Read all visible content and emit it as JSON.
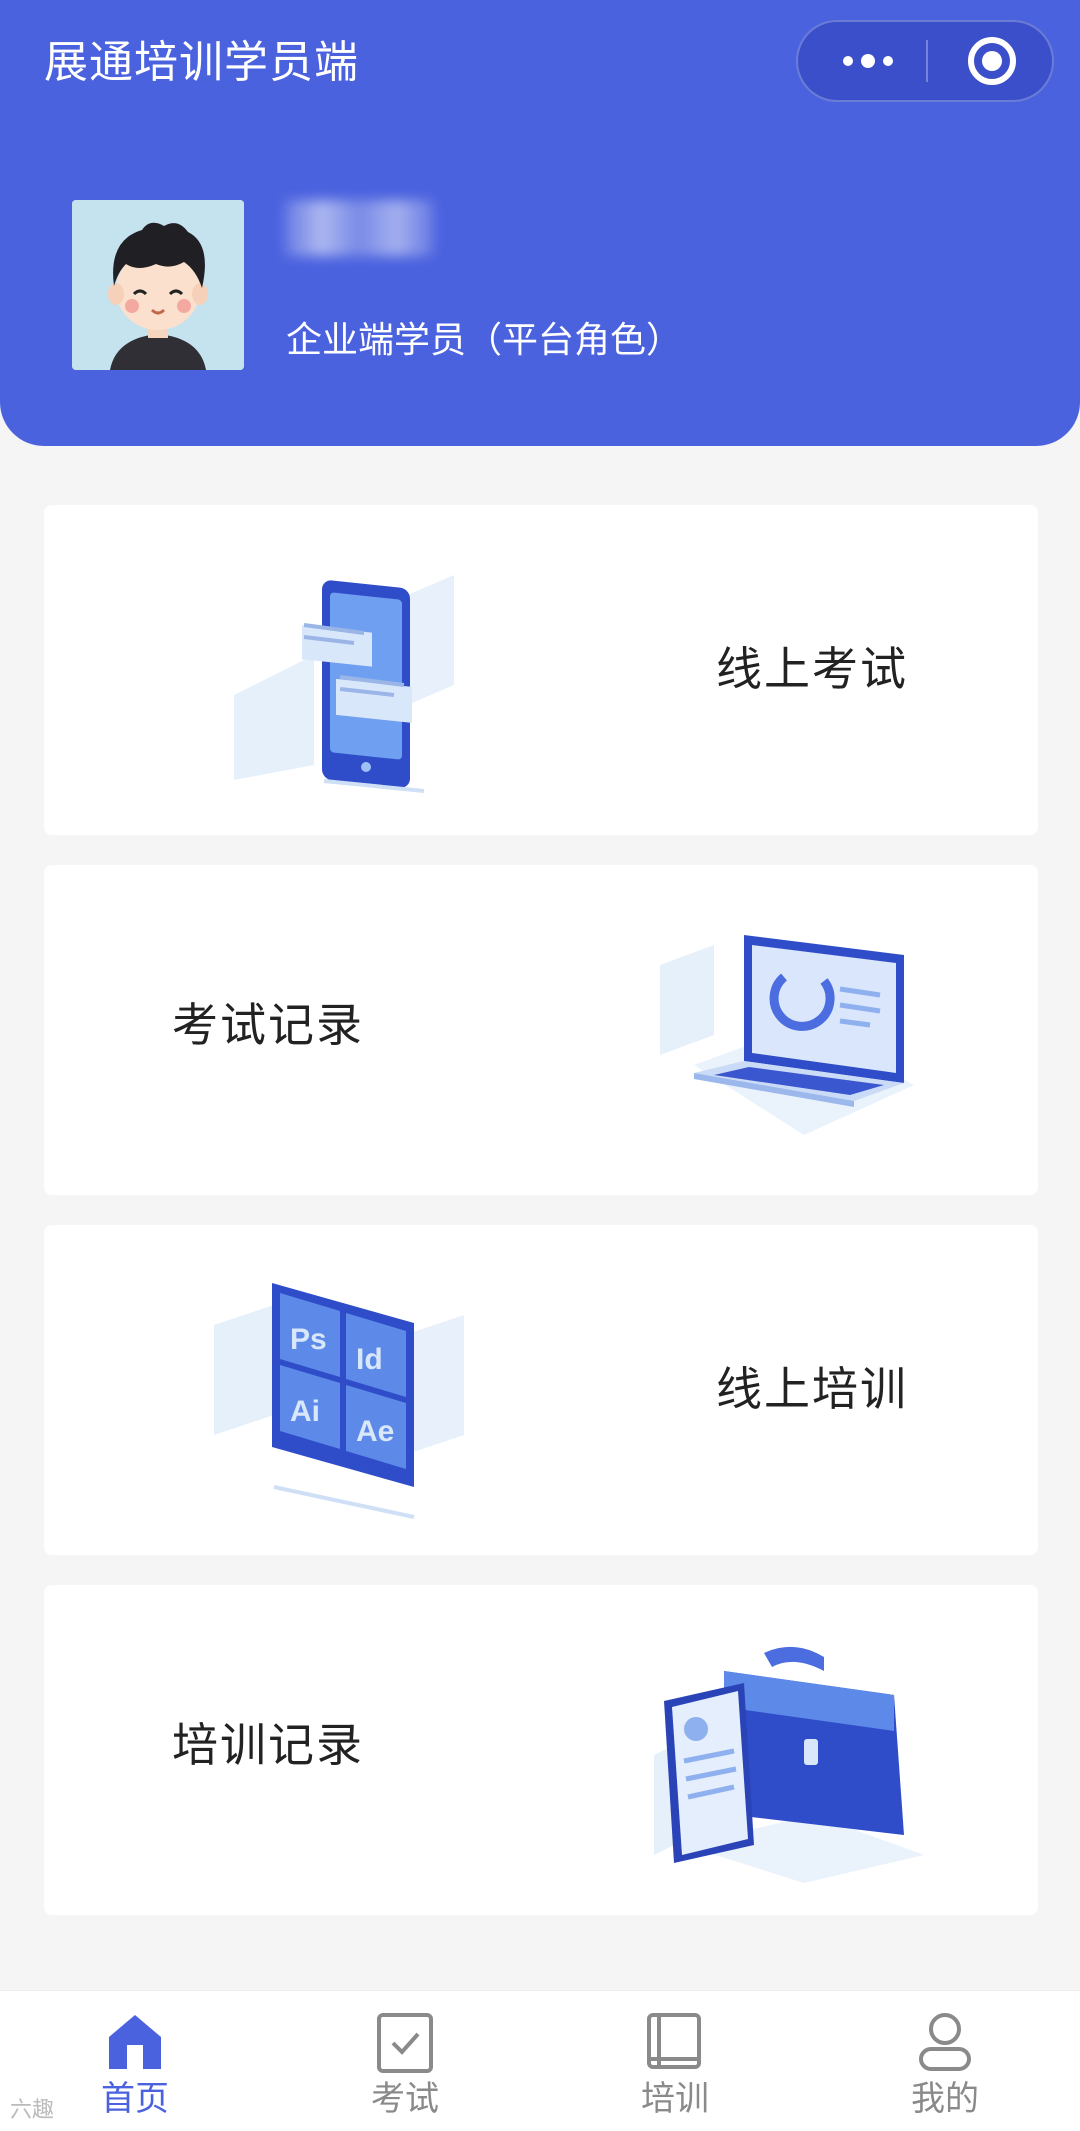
{
  "header": {
    "title": "展通培训学员端",
    "capsule": {
      "more_icon": "more-dots-icon",
      "close_icon": "target-circle-icon"
    },
    "user": {
      "avatar_icon": "cartoon-boy-avatar",
      "role": "企业端学员（平台角色）"
    },
    "colors": {
      "primary": "#4b62df"
    }
  },
  "cards": [
    {
      "label": "线上考试",
      "icon": "tablet-exam-illustration"
    },
    {
      "label": "考试记录",
      "icon": "laptop-chart-illustration"
    },
    {
      "label": "线上培训",
      "icon": "software-tiles-illustration",
      "tiles": [
        "Ps",
        "Id",
        "Ai",
        "Ae"
      ]
    },
    {
      "label": "培训记录",
      "icon": "briefcase-document-illustration"
    }
  ],
  "tabbar": [
    {
      "label": "首页",
      "icon": "home-icon",
      "active": true
    },
    {
      "label": "考试",
      "icon": "exam-check-icon",
      "active": false
    },
    {
      "label": "培训",
      "icon": "book-icon",
      "active": false
    },
    {
      "label": "我的",
      "icon": "user-icon",
      "active": false
    }
  ],
  "watermark": "六趣"
}
